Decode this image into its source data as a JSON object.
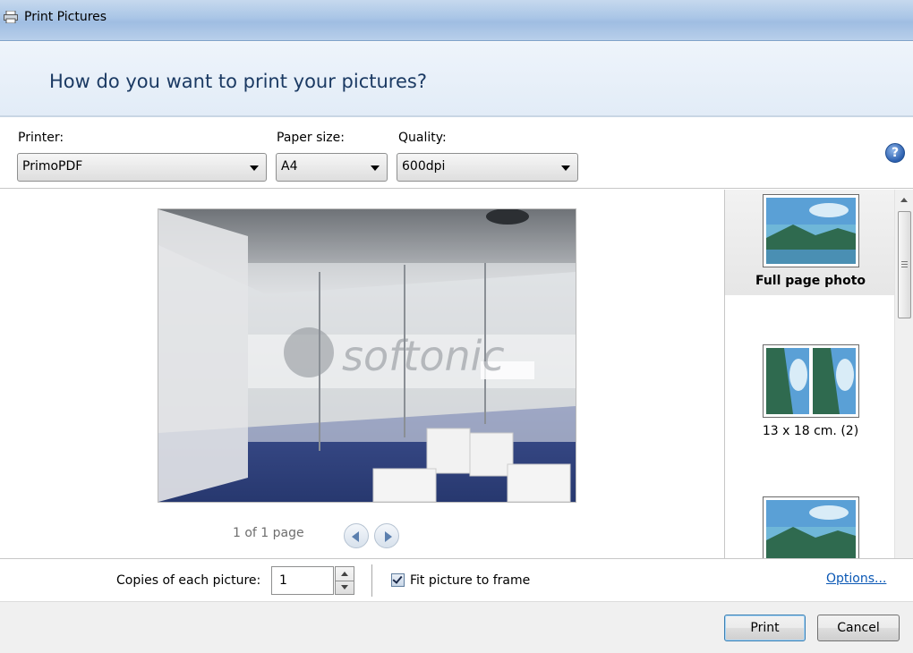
{
  "window": {
    "title": "Print Pictures"
  },
  "header": {
    "heading": "How do you want to print your pictures?"
  },
  "settings": {
    "printer": {
      "label": "Printer:",
      "value": "PrimoPDF"
    },
    "paper_size": {
      "label": "Paper size:",
      "value": "A4"
    },
    "quality": {
      "label": "Quality:",
      "value": "600dpi"
    },
    "help_icon": "help-icon"
  },
  "preview": {
    "page_count": "1 of 1 page",
    "watermark": "softonic"
  },
  "layouts": {
    "items": [
      {
        "label": "Full page photo",
        "selected": true
      },
      {
        "label": "13 x 18 cm. (2)",
        "selected": false
      },
      {
        "label": "",
        "selected": false
      }
    ]
  },
  "options": {
    "copies_label": "Copies of each picture:",
    "copies_value": "1",
    "fit_label": "Fit picture to frame",
    "fit_checked": true,
    "options_link": "Options..."
  },
  "footer": {
    "print_label": "Print",
    "cancel_label": "Cancel"
  },
  "colors": {
    "heading": "#1b3a63",
    "link": "#0b58b5",
    "titlebar": "#a9c5e6"
  }
}
